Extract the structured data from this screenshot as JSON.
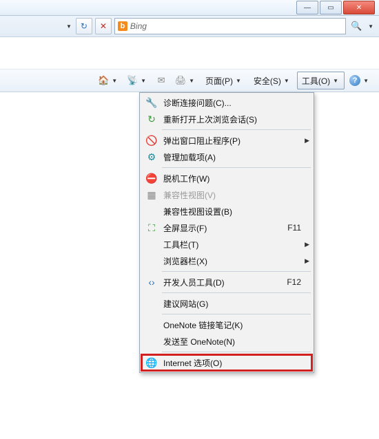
{
  "window_buttons": {
    "min": "—",
    "max": "▭",
    "close": "✕"
  },
  "addressbar": {
    "dropdown_glyph": "▼",
    "refresh_glyph": "↻",
    "stop_glyph": "✕",
    "bing_b": "b",
    "search_text": "Bing",
    "search_glyph": "🔍"
  },
  "toolbar": {
    "home_glyph": "🏠",
    "feeds_glyph": "📡",
    "mail_glyph": "✉",
    "print_glyph": "🖨",
    "page_label": "页面(P)",
    "safety_label": "安全(S)",
    "tools_label": "工具(O)",
    "help_glyph": "?",
    "dd": "▼"
  },
  "menu": {
    "items": [
      {
        "icon": "🔧",
        "icon_class": "c-blue",
        "label": "诊断连接问题(C)...",
        "hot": "",
        "sub": false
      },
      {
        "icon": "↻",
        "icon_class": "c-green",
        "label": "重新打开上次浏览会话(S)",
        "hot": "",
        "sub": false
      },
      {
        "sep": true
      },
      {
        "icon": "🚫",
        "icon_class": "c-orange",
        "label": "弹出窗口阻止程序(P)",
        "hot": "",
        "sub": true
      },
      {
        "icon": "⚙",
        "icon_class": "c-teal",
        "label": "管理加载项(A)",
        "hot": "",
        "sub": false
      },
      {
        "sep": true
      },
      {
        "icon": "⛔",
        "icon_class": "c-red",
        "label": "脱机工作(W)",
        "hot": "",
        "sub": false
      },
      {
        "icon": "▦",
        "icon_class": "c-gray",
        "label": "兼容性视图(V)",
        "hot": "",
        "sub": false,
        "disabled": true
      },
      {
        "icon": "",
        "icon_class": "",
        "label": "兼容性视图设置(B)",
        "hot": "",
        "sub": false
      },
      {
        "icon": "⛶",
        "icon_class": "c-green",
        "label": "全屏显示(F)",
        "hot": "F11",
        "sub": false
      },
      {
        "icon": "",
        "icon_class": "",
        "label": "工具栏(T)",
        "hot": "",
        "sub": true
      },
      {
        "icon": "",
        "icon_class": "",
        "label": "浏览器栏(X)",
        "hot": "",
        "sub": true
      },
      {
        "sep": true
      },
      {
        "icon": "‹›",
        "icon_class": "c-blue",
        "label": "开发人员工具(D)",
        "hot": "F12",
        "sub": false
      },
      {
        "sep": true
      },
      {
        "icon": "",
        "icon_class": "",
        "label": "建议网站(G)",
        "hot": "",
        "sub": false
      },
      {
        "sep": true
      },
      {
        "icon": "",
        "icon_class": "",
        "label": "OneNote 链接笔记(K)",
        "hot": "",
        "sub": false
      },
      {
        "icon": "",
        "icon_class": "",
        "label": "发送至 OneNote(N)",
        "hot": "",
        "sub": false
      },
      {
        "sep": true
      },
      {
        "icon": "🌐",
        "icon_class": "c-blue",
        "label": "Internet 选项(O)",
        "hot": "",
        "sub": false,
        "highlight": true
      }
    ]
  }
}
